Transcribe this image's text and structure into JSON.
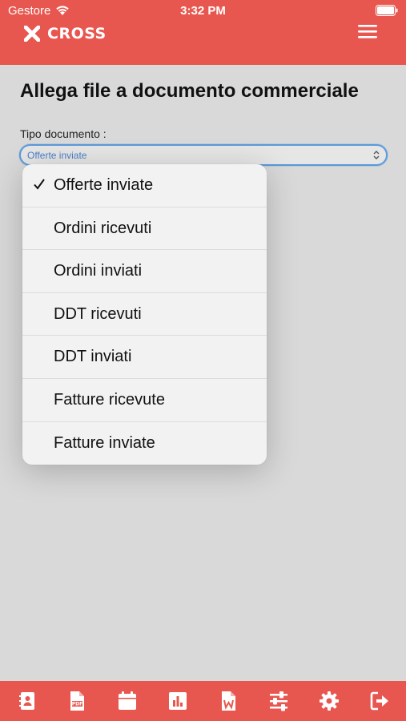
{
  "status_bar": {
    "carrier": "Gestore",
    "time": "3:32 PM"
  },
  "header": {
    "logo_text": "CROSS",
    "logo_icon": "x-logo-icon",
    "menu_icon": "hamburger-menu-icon"
  },
  "page": {
    "title": "Allega file a documento commerciale",
    "field_label": "Tipo documento :",
    "selected_value": "Offerte inviate"
  },
  "dropdown": {
    "options": [
      {
        "label": "Offerte inviate",
        "selected": true
      },
      {
        "label": "Ordini ricevuti",
        "selected": false
      },
      {
        "label": "Ordini inviati",
        "selected": false
      },
      {
        "label": "DDT ricevuti",
        "selected": false
      },
      {
        "label": "DDT inviati",
        "selected": false
      },
      {
        "label": "Fatture ricevute",
        "selected": false
      },
      {
        "label": "Fatture inviate",
        "selected": false
      }
    ]
  },
  "toolbar": {
    "items": [
      "contacts-icon",
      "pdf-file-icon",
      "calendar-icon",
      "bar-chart-icon",
      "word-file-icon",
      "settings-sliders-icon",
      "gear-icon",
      "logout-icon"
    ]
  },
  "colors": {
    "brand": "#e8574f",
    "focus": "#5b9ad9",
    "background": "#d9d9d9"
  }
}
